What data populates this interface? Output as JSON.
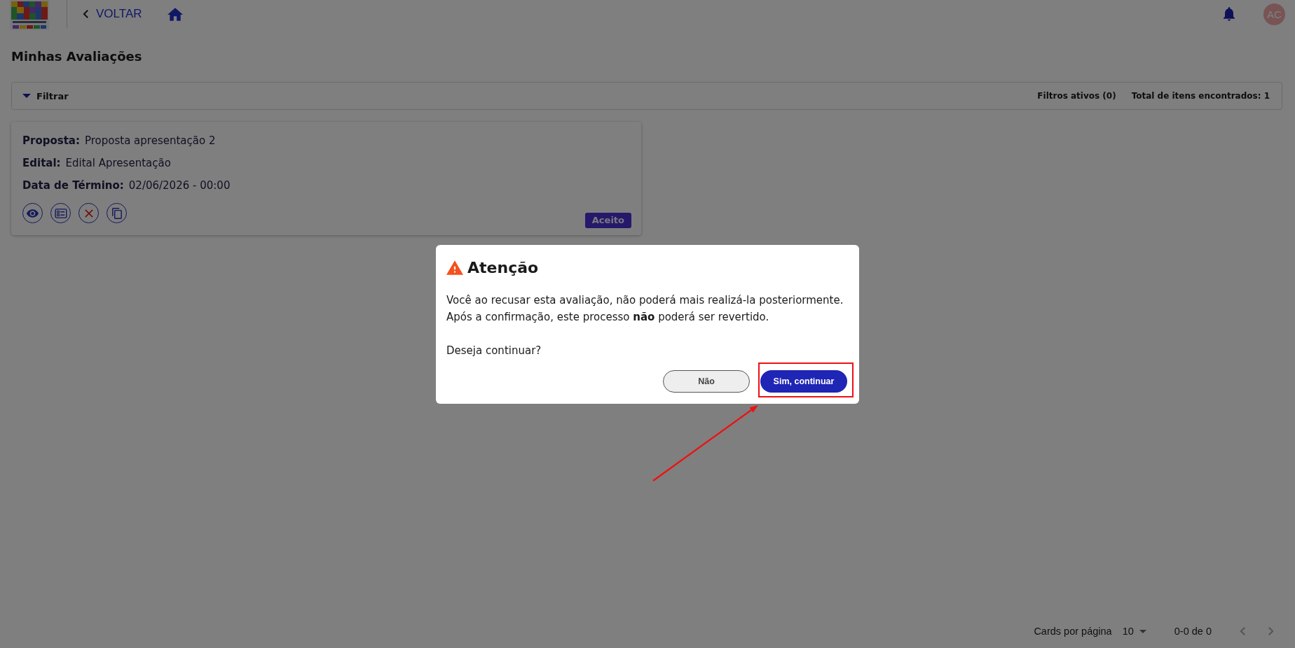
{
  "header": {
    "back_label": "VOLTAR",
    "avatar_initials": "AC"
  },
  "page_title": "Minhas Avaliações",
  "filter_bar": {
    "toggle_label": "Filtrar",
    "active_filters": "Filtros ativos (0)",
    "total": "Total de itens encontrados: 1"
  },
  "cards": [
    {
      "fields": [
        {
          "label": "Proposta:",
          "value": "Proposta apresentação 2"
        },
        {
          "label": "Edital:",
          "value": "Edital Apresentação"
        },
        {
          "label": "Data de Término:",
          "value": "02/06/2026 - 00:00"
        }
      ],
      "actions": [
        {
          "kind": "view"
        },
        {
          "kind": "checklist"
        },
        {
          "kind": "refuse"
        },
        {
          "kind": "copy"
        }
      ],
      "status": "Aceito"
    }
  ],
  "pagination": {
    "label": "Cards por página",
    "per_page": "10",
    "range": "0-0 de 0",
    "previous": {
      "disabled": true
    },
    "next": {
      "disabled": true
    }
  },
  "dialog": {
    "title": "Atenção",
    "message": [
      "Você ao recusar esta avaliação, não poderá mais realizá-la posteriormente.",
      "Após a confirmação, este processo **não** poderá ser revertido."
    ],
    "question": "Deseja continuar?",
    "buttons": [
      {
        "label": "Não",
        "kind": "secondary",
        "highlighted": false
      },
      {
        "label": "Sim, continuar",
        "kind": "primary",
        "highlighted": true
      }
    ]
  }
}
